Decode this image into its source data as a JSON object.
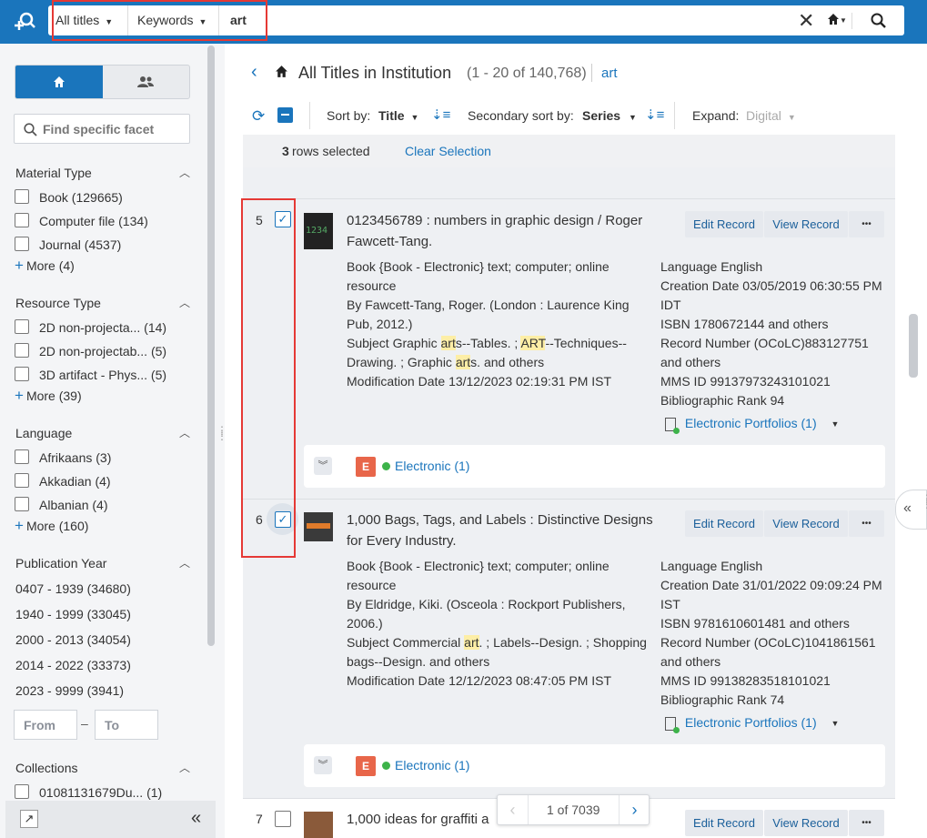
{
  "search": {
    "scope": "All titles",
    "field": "Keywords",
    "query": "art"
  },
  "sidebar": {
    "facet_search_placeholder": "Find specific facet",
    "facets": [
      {
        "title": "Material Type",
        "items": [
          "Book (129665)",
          "Computer file (134)",
          "Journal (4537)"
        ],
        "more": "More (4)"
      },
      {
        "title": "Resource Type",
        "items": [
          "2D non-projecta... (14)",
          "2D non-projectab... (5)",
          "3D artifact - Phys... (5)"
        ],
        "more": "More (39)"
      },
      {
        "title": "Language",
        "items": [
          "Afrikaans (3)",
          "Akkadian (4)",
          "Albanian (4)"
        ],
        "more": "More (160)"
      }
    ],
    "pubyear": {
      "title": "Publication Year",
      "ranges": [
        "0407 - 1939 (34680)",
        "1940 - 1999 (33045)",
        "2000 - 2013 (34054)",
        "2014 - 2022 (33373)",
        "2023 - 9999 (3941)"
      ],
      "from_placeholder": "From",
      "dash": "–",
      "to_placeholder": "To"
    },
    "collections": {
      "title": "Collections",
      "items": [
        "01081131679Du... (1)"
      ]
    }
  },
  "header": {
    "title": "All Titles in Institution",
    "count": "(1 - 20 of 140,768)",
    "query_link": "art"
  },
  "toolbar": {
    "sort_by_label": "Sort by:",
    "sort_by_value": "Title",
    "secondary_label": "Secondary sort by:",
    "secondary_value": "Series",
    "expand_label": "Expand:",
    "expand_value": "Digital"
  },
  "selection": {
    "count": "3",
    "rows_selected": "rows selected",
    "clear": "Clear Selection"
  },
  "records": [
    {
      "num": "5",
      "checked": true,
      "title_1": "0123456789 : numbers in graphic design / Roger",
      "title_2": "Fawcett-Tang.",
      "left": {
        "type_1": "Book {Book - Electronic} text; computer; online",
        "type_2": "resource",
        "by_label": "By",
        "by_1": "Fawcett-Tang, Roger. (London : Laurence King",
        "by_2": "Pub, 2012.)",
        "subj_label": "Subject",
        "subj_a": "Graphic ",
        "subj_hl1": "art",
        "subj_b": "s--Tables. ; ",
        "subj_hl2": "ART",
        "subj_c": "--Techniques--",
        "subj_d": "Drawing. ; Graphic ",
        "subj_hl3": "art",
        "subj_e": "s. and others",
        "mod_label": "Modification Date",
        "mod": "13/12/2023 02:19:31 PM IST"
      },
      "right": {
        "lang_label": "Language",
        "lang": "English",
        "created_label": "Creation Date",
        "created_1": "03/05/2019 06:30:55 PM",
        "created_2": "IDT",
        "isbn_label": "ISBN",
        "isbn": "1780672144 and others",
        "recnum_label": "Record Number",
        "recnum_1": "(OCoLC)883127751",
        "recnum_2": "and others",
        "mms_label": "MMS ID",
        "mms": "99137973243101021",
        "rank_label": "Bibliographic Rank",
        "rank": "94",
        "portfolios": "Electronic Portfolios (1)"
      },
      "electronic": "Electronic (1)"
    },
    {
      "num": "6",
      "checked": true,
      "title_1": "1,000 Bags, Tags, and Labels : Distinctive Designs",
      "title_2": "for Every Industry.",
      "left": {
        "type_1": "Book {Book - Electronic} text; computer; online",
        "type_2": "resource",
        "by_label": "By",
        "by_1": "Eldridge, Kiki. (Osceola : Rockport Publishers,",
        "by_2": "2006.)",
        "subj_label": "Subject",
        "subj_a": "Commercial ",
        "subj_hl1": "art",
        "subj_b": ". ; Labels--Design. ; Shopping",
        "subj_c": "bags--Design. and others",
        "mod_label": "Modification Date",
        "mod": "12/12/2023 08:47:05 PM IST"
      },
      "right": {
        "lang_label": "Language",
        "lang": "English",
        "created_label": "Creation Date",
        "created_1": "31/01/2022 09:09:24 PM",
        "created_2": "IST",
        "isbn_label": "ISBN",
        "isbn": "9781610601481 and others",
        "recnum_label": "Record Number",
        "recnum_1": "(OCoLC)1041861561",
        "recnum_2": "and others",
        "mms_label": "MMS ID",
        "mms": "99138283518101021",
        "rank_label": "Bibliographic Rank",
        "rank": "74",
        "portfolios": "Electronic Portfolios (1)"
      },
      "electronic": "Electronic (1)"
    },
    {
      "num": "7",
      "checked": false,
      "title_1": "1,000 ideas for graffiti a"
    }
  ],
  "buttons": {
    "edit": "Edit Record",
    "view": "View Record",
    "more": "•••"
  },
  "pager": {
    "text": "1 of 7039"
  },
  "colors": {
    "primary": "#1a75bc",
    "highlight": "#fdeea6",
    "selection_outline": "#e53935",
    "electronic_badge": "#e8664a",
    "available": "#3db34a"
  }
}
